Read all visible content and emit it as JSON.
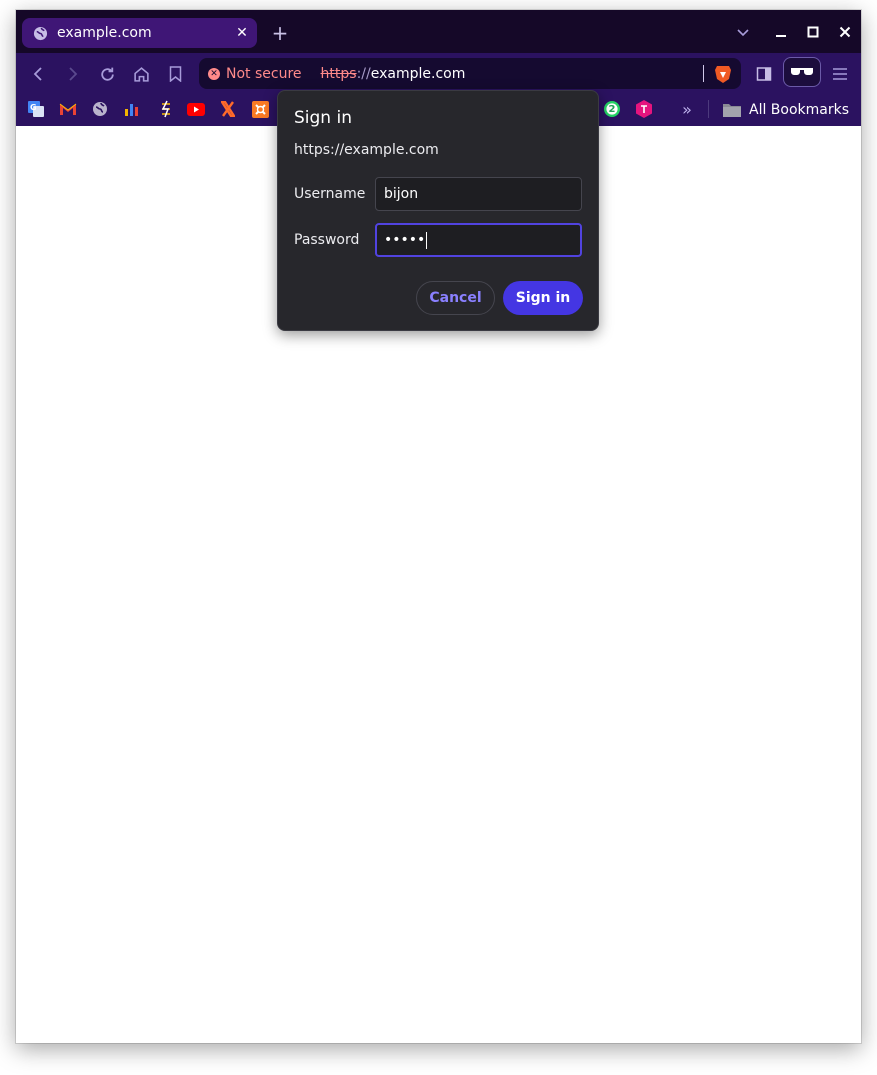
{
  "tab": {
    "title": "example.com",
    "close": "✕"
  },
  "new_tab": "+",
  "omnibox": {
    "security": "Not secure",
    "scheme": "https",
    "separator": "://",
    "host": "example.com"
  },
  "bookmarks": {
    "items": [
      "google-translate",
      "gmail",
      "globe",
      "analytics",
      "bolt",
      "youtube",
      "x-logo",
      "xampp",
      "whatsapp-badge",
      "toggl"
    ],
    "whatsapp_badge": "2",
    "more": "»",
    "all_label": "All Bookmarks"
  },
  "dialog": {
    "title": "Sign in",
    "origin": "https://example.com",
    "username_label": "Username",
    "username_value": "bijon",
    "password_label": "Password",
    "password_value": "•••••",
    "cancel_label": "Cancel",
    "signin_label": "Sign in"
  },
  "colors": {
    "tabstrip": "#150828",
    "toolbar": "#2b1260",
    "accent": "#4436e3",
    "warning": "#ff8a8a"
  }
}
